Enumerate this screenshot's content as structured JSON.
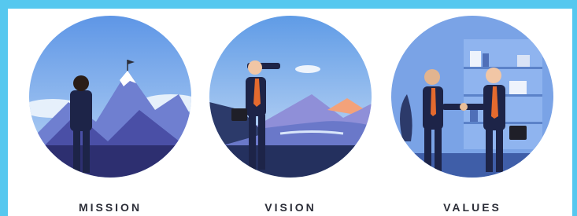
{
  "panels": [
    {
      "label": "MISSION",
      "icon": "mountain-flag-illustration"
    },
    {
      "label": "VISION",
      "icon": "telescope-illustration"
    },
    {
      "label": "VALUES",
      "icon": "handshake-illustration"
    }
  ],
  "colors": {
    "border": "#56c8ef",
    "sky": "#6aa7e8",
    "mountain": "#5560b8",
    "suit": "#1d2448",
    "tie": "#e46a2e"
  }
}
